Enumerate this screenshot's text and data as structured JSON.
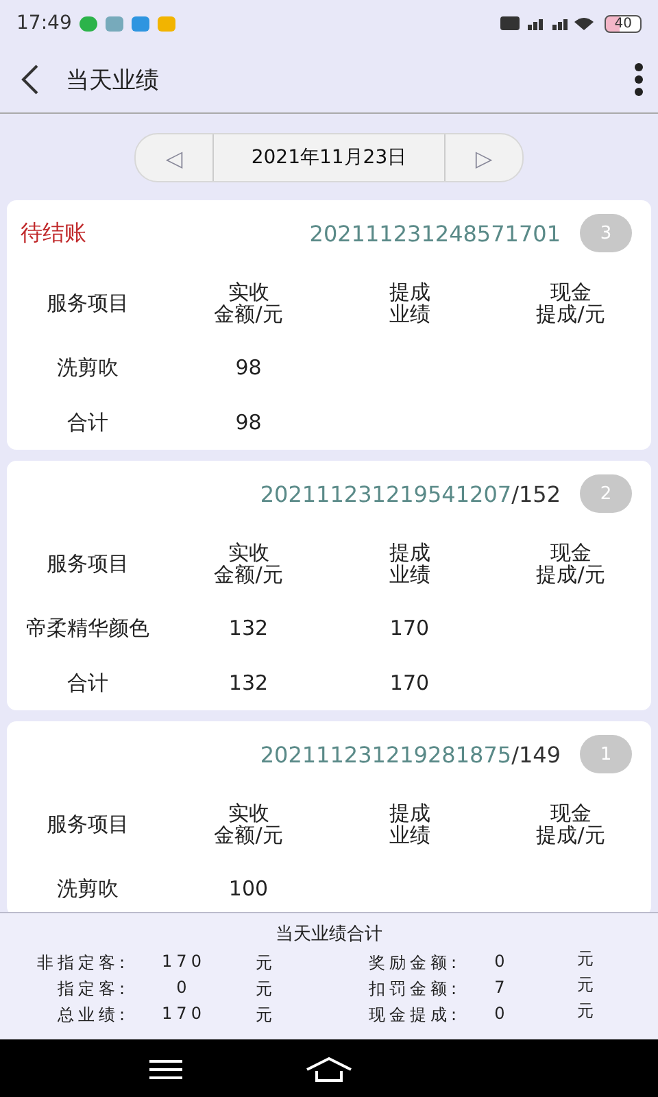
{
  "status_bar": {
    "time": "17:49",
    "battery": "40"
  },
  "header": {
    "title": "当天业绩"
  },
  "date_nav": {
    "prev": "◁",
    "date": "2021年11月23日",
    "next": "▷"
  },
  "orders": [
    {
      "status": "待结账",
      "order_no": "202111231248571701",
      "count": "3",
      "columns": [
        [
          "服务项目"
        ],
        [
          "实收",
          "金额/元"
        ],
        [
          "提成",
          "业绩"
        ],
        [
          "现金",
          "提成/元"
        ]
      ],
      "rows": [
        {
          "item": "洗剪吹",
          "amount": "98"
        },
        {
          "item": "合计",
          "amount": "98"
        }
      ]
    },
    {
      "order_no": "202111231219541207",
      "suffix": "/152",
      "count": "2",
      "columns": [
        [
          "服务项目"
        ],
        [
          "实收",
          "金额/元"
        ],
        [
          "提成",
          "业绩"
        ],
        [
          "现金",
          "提成/元"
        ]
      ],
      "rows": [
        {
          "item": "帝柔精华颜色",
          "amount": "132",
          "commission": "170"
        },
        {
          "item": "合计",
          "amount": "132",
          "commission": "170"
        }
      ]
    },
    {
      "order_no": "202111231219281875",
      "suffix": "/149",
      "count": "1",
      "columns": [
        [
          "服务项目"
        ],
        [
          "实收",
          "金额/元"
        ],
        [
          "提成",
          "业绩"
        ],
        [
          "现金",
          "提成/元"
        ]
      ],
      "rows": [
        {
          "item": "洗剪吹",
          "amount": "100"
        }
      ]
    }
  ],
  "summary": {
    "title": "当天业绩合计",
    "left": [
      {
        "label": "非指定客:",
        "value": "170",
        "unit": "元"
      },
      {
        "label": "指定客:",
        "value": "0",
        "unit": "元"
      },
      {
        "label": "总业绩:",
        "value": "170",
        "unit": "元"
      }
    ],
    "right": [
      {
        "label": "奖励金额:",
        "value": "0",
        "unit": "元"
      },
      {
        "label": "扣罚金额:",
        "value": "7",
        "unit": "元"
      },
      {
        "label": "现金提成:",
        "value": "0",
        "unit": "元"
      }
    ]
  }
}
